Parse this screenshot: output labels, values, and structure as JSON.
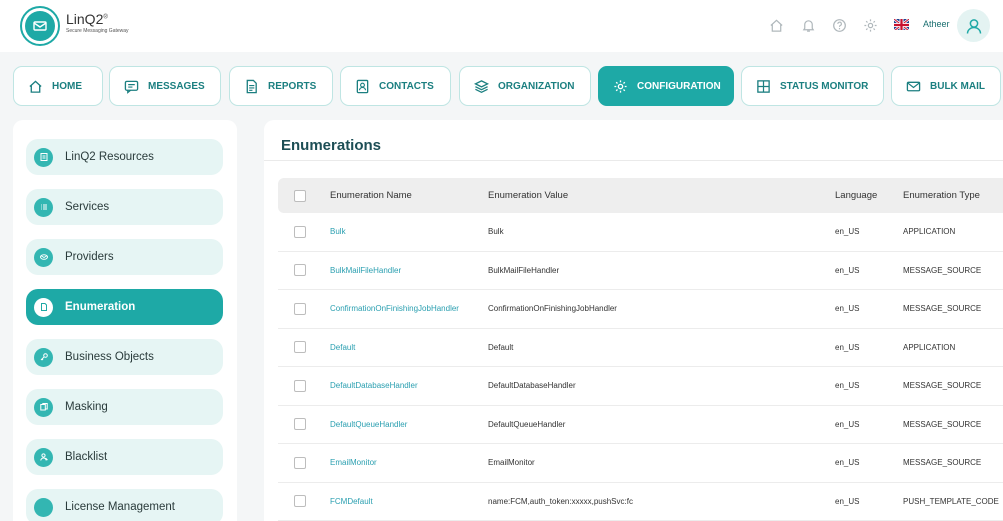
{
  "header": {
    "brand": "LinQ2",
    "brand_mark": "®",
    "tagline": "Secure Messaging Gateway",
    "username": "Atheer",
    "icons": [
      "home-icon",
      "bell-icon",
      "help-icon",
      "gear-icon",
      "uk-flag-icon",
      "user-icon"
    ]
  },
  "nav": {
    "tabs": [
      {
        "label": "HOME",
        "icon": "home-icon"
      },
      {
        "label": "MESSAGES",
        "icon": "message-icon"
      },
      {
        "label": "REPORTS",
        "icon": "document-icon"
      },
      {
        "label": "CONTACTS",
        "icon": "contacts-icon"
      },
      {
        "label": "ORGANIZATION",
        "icon": "layers-icon"
      },
      {
        "label": "CONFIGURATION",
        "icon": "gear-icon",
        "active": true
      },
      {
        "label": "STATUS MONITOR",
        "icon": "grid-icon"
      },
      {
        "label": "BULK MAIL",
        "icon": "mail-icon"
      }
    ]
  },
  "sidebar": {
    "items": [
      {
        "label": "LinQ2 Resources",
        "icon": "resources-icon"
      },
      {
        "label": "Services",
        "icon": "list-icon"
      },
      {
        "label": "Providers",
        "icon": "providers-icon"
      },
      {
        "label": "Enumeration",
        "icon": "document-icon",
        "active": true
      },
      {
        "label": "Business Objects",
        "icon": "key-icon"
      },
      {
        "label": "Masking",
        "icon": "copy-icon"
      },
      {
        "label": "Blacklist",
        "icon": "blacklist-user-icon"
      },
      {
        "label": "License Management",
        "icon": "license-icon"
      }
    ]
  },
  "main": {
    "title": "Enumerations",
    "columns": [
      "Enumeration Name",
      "Enumeration Value",
      "Language",
      "Enumeration Type"
    ],
    "rows": [
      {
        "name": "Bulk",
        "value": "Bulk",
        "language": "en_US",
        "type": "APPLICATION"
      },
      {
        "name": "BulkMailFileHandler",
        "value": "BulkMailFileHandler",
        "language": "en_US",
        "type": "MESSAGE_SOURCE"
      },
      {
        "name": "ConfirmationOnFinishingJobHandler",
        "value": "ConfirmationOnFinishingJobHandler",
        "language": "en_US",
        "type": "MESSAGE_SOURCE"
      },
      {
        "name": "Default",
        "value": "Default",
        "language": "en_US",
        "type": "APPLICATION"
      },
      {
        "name": "DefaultDatabaseHandler",
        "value": "DefaultDatabaseHandler",
        "language": "en_US",
        "type": "MESSAGE_SOURCE"
      },
      {
        "name": "DefaultQueueHandler",
        "value": "DefaultQueueHandler",
        "language": "en_US",
        "type": "MESSAGE_SOURCE"
      },
      {
        "name": "EmailMonitor",
        "value": "EmailMonitor",
        "language": "en_US",
        "type": "MESSAGE_SOURCE"
      },
      {
        "name": "FCMDefault",
        "value": "name:FCM,auth_token:xxxxx,pushSvc:fc",
        "language": "en_US",
        "type": "PUSH_TEMPLATE_CODE"
      }
    ]
  },
  "colors": {
    "accent": "#1ea9a6",
    "accent_light": "#e6f5f4",
    "link": "#2a9fb0",
    "title": "#1d4e55"
  }
}
